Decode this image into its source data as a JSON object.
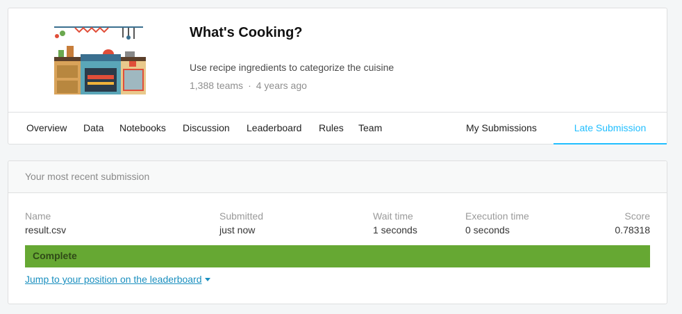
{
  "competition": {
    "title": "What's Cooking?",
    "subtitle": "Use recipe ingredients to categorize the cuisine",
    "teams": "1,388 teams",
    "separator": "·",
    "age": "4 years ago",
    "illustration_icon": "kitchen-illustration-icon"
  },
  "tabs": {
    "left": [
      "Overview",
      "Data",
      "Notebooks",
      "Discussion",
      "Leaderboard",
      "Rules",
      "Team"
    ],
    "my_submissions": "My Submissions",
    "late_submission": "Late Submission",
    "active": "Late Submission"
  },
  "submission": {
    "heading": "Your most recent submission",
    "columns": {
      "name": {
        "label": "Name",
        "value": "result.csv"
      },
      "submitted": {
        "label": "Submitted",
        "value": "just now"
      },
      "wait": {
        "label": "Wait time",
        "value": "1 seconds"
      },
      "execution": {
        "label": "Execution time",
        "value": "0 seconds"
      },
      "score": {
        "label": "Score",
        "value": "0.78318"
      }
    },
    "status": "Complete",
    "jump_link": "Jump to your position on the leaderboard"
  },
  "colors": {
    "accent": "#20beff",
    "status_green": "#66a833",
    "link": "#1a8fbf"
  }
}
